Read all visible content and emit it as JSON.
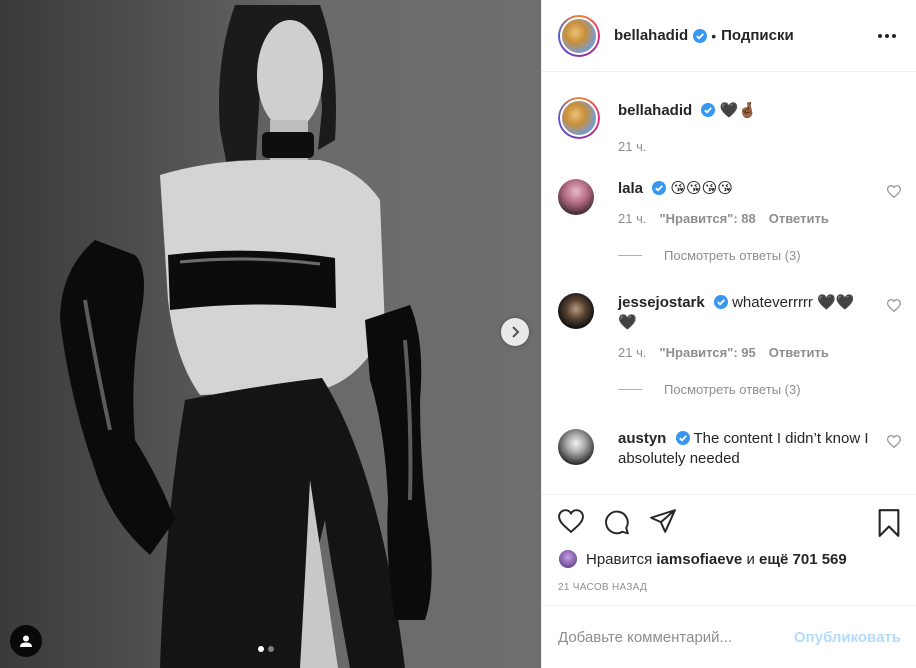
{
  "post": {
    "username": "bellahadid",
    "bullet": "•",
    "follow_label": "Подписки",
    "caption": "🖤🤞🏾",
    "caption_time": "21 ч."
  },
  "comments": [
    {
      "username": "lala",
      "text": "😘😘😘😘",
      "time": "21 ч.",
      "likes": "\"Нравится\": 88",
      "reply": "Ответить",
      "view_replies": "Посмотреть ответы (3)"
    },
    {
      "username": "jessejostark",
      "text": "whateverrrrr 🖤🖤🖤",
      "time": "21 ч.",
      "likes": "\"Нравится\": 95",
      "reply": "Ответить",
      "view_replies": "Посмотреть ответы (3)"
    },
    {
      "username": "austyn",
      "text": "The content I didn’t know I absolutely needed"
    }
  ],
  "likes_line": {
    "prefix": "Нравится",
    "user": "iamsofiaeve",
    "middle": "и",
    "count": "ещё 701 569"
  },
  "timestamp": "21 ЧАСОВ НАЗАД",
  "add_comment": {
    "placeholder": "Добавьте комментарий...",
    "post_label": "Опубликовать"
  },
  "carousel": {
    "slides": 2,
    "active": 1
  },
  "colors": {
    "verified": "#3897f0",
    "post_disabled": "#b3dbff",
    "muted": "#8e8e8e"
  }
}
